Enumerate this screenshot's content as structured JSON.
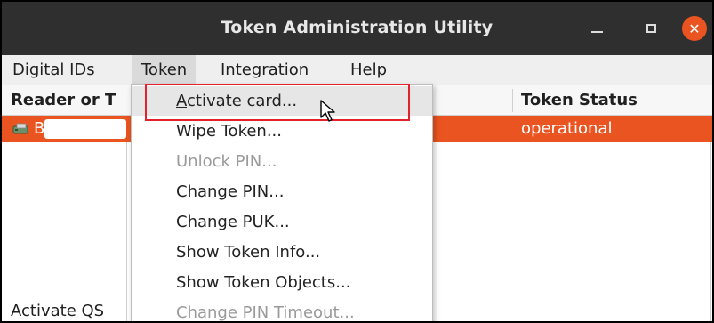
{
  "window": {
    "title": "Token Administration Utility",
    "controls": {
      "minimize_icon": "minimize-icon",
      "maximize_icon": "maximize-icon",
      "close_icon": "close-icon",
      "close_color": "#e95420"
    }
  },
  "menubar": {
    "items": [
      {
        "label": "Digital IDs"
      },
      {
        "label": "Token"
      },
      {
        "label": "Integration"
      },
      {
        "label": "Help"
      }
    ]
  },
  "table": {
    "headers": [
      "Reader or T",
      "Token Status"
    ],
    "rows": [
      {
        "name": "B",
        "status": "operational",
        "icon": "card-reader-icon"
      }
    ],
    "selection_color": "#e95420"
  },
  "status_bar": {
    "text": "Activate QS"
  },
  "token_menu": {
    "items": [
      {
        "label": "Activate card...",
        "mnemonic": "A",
        "rest": "ctivate card...",
        "enabled": true,
        "hovered": true
      },
      {
        "label": "Wipe Token...",
        "enabled": true
      },
      {
        "label": "Unlock PIN...",
        "enabled": false
      },
      {
        "label": "Change PIN...",
        "enabled": true
      },
      {
        "label": "Change PUK...",
        "enabled": true
      },
      {
        "label": "Show Token Info...",
        "enabled": true
      },
      {
        "label": "Show Token Objects...",
        "enabled": true
      },
      {
        "label": "Change PIN Timeout...",
        "enabled": false
      }
    ],
    "highlight_color": "#e3212b"
  }
}
